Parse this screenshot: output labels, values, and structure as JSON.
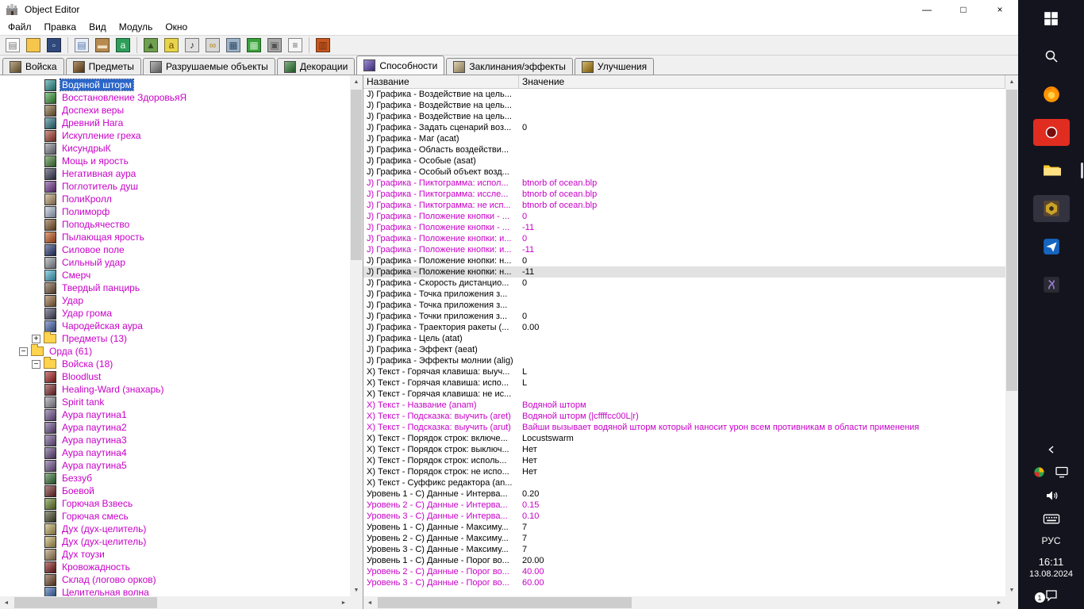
{
  "colors": {
    "modified_text": "#c800c8",
    "tree_selection_bg": "#2b66c9",
    "row_selection_bg": "#e2e2e2",
    "taskbar_bg": "#14141f",
    "red_app_highlight": "#e02d20"
  },
  "window": {
    "title": "Object Editor",
    "controls": {
      "minimize": "—",
      "maximize": "□",
      "close": "×"
    }
  },
  "menu": {
    "items": [
      {
        "name": "file",
        "label": "Файл"
      },
      {
        "name": "edit",
        "label": "Правка"
      },
      {
        "name": "view",
        "label": "Вид"
      },
      {
        "name": "module",
        "label": "Модуль"
      },
      {
        "name": "window",
        "label": "Окно"
      }
    ]
  },
  "toolbar": {
    "icons": [
      {
        "name": "new-document",
        "bg": "#fdfdfd",
        "fg": "#777777",
        "glyph": "▤"
      },
      {
        "name": "open-folder",
        "bg": "#f6c64c",
        "fg": "#7c5a14",
        "glyph": ""
      },
      {
        "name": "save",
        "bg": "#30497c",
        "fg": "#cfd8ea",
        "glyph": "▫"
      },
      {
        "name": "copy",
        "bg": "#e8eef8",
        "fg": "#5577aa",
        "glyph": "▤",
        "sep": true
      },
      {
        "name": "paste",
        "bg": "#b78a50",
        "fg": "#f0e0c0",
        "glyph": "▬"
      },
      {
        "name": "paste-special",
        "bg": "#2e9e5b",
        "fg": "#eaffea",
        "glyph": "a"
      },
      {
        "name": "terrain-editor",
        "bg": "#6f9f4f",
        "fg": "#2f4f1f",
        "glyph": "▲",
        "sep": true
      },
      {
        "name": "script-editor",
        "bg": "#e8d44a",
        "fg": "#6a4a00",
        "glyph": "a"
      },
      {
        "name": "sound-editor",
        "bg": "#e0e0e0",
        "fg": "#333333",
        "glyph": "♪"
      },
      {
        "name": "object-editor",
        "bg": "#d8d8d8",
        "fg": "#b8860b",
        "glyph": "∞"
      },
      {
        "name": "calculator",
        "bg": "#9fb4c8",
        "fg": "#2f4a66",
        "glyph": "▦"
      },
      {
        "name": "terrain-grid",
        "bg": "#3aa13a",
        "fg": "#c6edc6",
        "glyph": "▦"
      },
      {
        "name": "object-manager",
        "bg": "#a8a8a8",
        "fg": "#555555",
        "glyph": "▣"
      },
      {
        "name": "import-manager",
        "bg": "#f6f6f6",
        "fg": "#666666",
        "glyph": "≡"
      },
      {
        "name": "test-map",
        "bg": "#c8571e",
        "fg": "#6e2e10",
        "glyph": "▥",
        "sep": true
      }
    ]
  },
  "tabs": {
    "items": [
      {
        "name": "units",
        "label": "Войска",
        "color": "#8a6d3b",
        "active": false
      },
      {
        "name": "items",
        "label": "Предметы",
        "color": "#7b4a12",
        "active": false
      },
      {
        "name": "destructibles",
        "label": "Разрушаемые объекты",
        "color": "#888888",
        "active": false
      },
      {
        "name": "doodads",
        "label": "Декорации",
        "color": "#2e7d32",
        "active": false
      },
      {
        "name": "abilities",
        "label": "Способности",
        "color": "#5a3fb5",
        "active": true
      },
      {
        "name": "buffs",
        "label": "Заклинания/эффекты",
        "color": "#c9b37e",
        "active": false
      },
      {
        "name": "upgrades",
        "label": "Улучшения",
        "color": "#b8860b",
        "active": false
      }
    ]
  },
  "tree": {
    "items": [
      {
        "t": "Водяной шторм",
        "d": 3,
        "c": "#2e9e9e",
        "sel": true
      },
      {
        "t": "Восстановление ЗдоровьяЯ",
        "d": 3,
        "c": "#3da53d"
      },
      {
        "t": "Доспехи веры",
        "d": 3,
        "c": "#8a6a3a"
      },
      {
        "t": "Древний Нага",
        "d": 3,
        "c": "#2e7e8e"
      },
      {
        "t": "Искупление греха",
        "d": 3,
        "c": "#b04030"
      },
      {
        "t": "КисундрыК",
        "d": 3,
        "c": "#8a8a9a"
      },
      {
        "t": "Мощь и ярость",
        "d": 3,
        "c": "#4a8a3a"
      },
      {
        "t": "Негативная аура",
        "d": 3,
        "c": "#3a3a5a"
      },
      {
        "t": "Поглотитель душ",
        "d": 3,
        "c": "#7a3a9a"
      },
      {
        "t": "ПолиКролл",
        "d": 3,
        "c": "#c0a070"
      },
      {
        "t": "Полиморф",
        "d": 3,
        "c": "#b8c8e0"
      },
      {
        "t": "Поподьячество",
        "d": 3,
        "c": "#8a5a2a"
      },
      {
        "t": "Пылающая ярость",
        "d": 3,
        "c": "#d05a1a"
      },
      {
        "t": "Силовое поле",
        "d": 3,
        "c": "#2a3a7a"
      },
      {
        "t": "Сильный удар",
        "d": 3,
        "c": "#9aa0a8"
      },
      {
        "t": "Смерч",
        "d": 3,
        "c": "#4ab8d8"
      },
      {
        "t": "Твердый панцирь",
        "d": 3,
        "c": "#7a5a3a"
      },
      {
        "t": "Удар",
        "d": 3,
        "c": "#a07040"
      },
      {
        "t": "Удар грома",
        "d": 3,
        "c": "#4a4a6a"
      },
      {
        "t": "Чародейская аура",
        "d": 3,
        "c": "#4a6ab8"
      },
      {
        "t": "Предметы (13)",
        "d": 2,
        "folder": true,
        "exp": "plus"
      },
      {
        "t": "Орда (61)",
        "d": 1,
        "folder": true,
        "exp": "minus"
      },
      {
        "t": "Войска (18)",
        "d": 2,
        "folder": true,
        "exp": "minus"
      },
      {
        "t": "Bloodlust",
        "d": 3,
        "c": "#b02020"
      },
      {
        "t": "Healing-Ward (знахарь)",
        "d": 3,
        "c": "#8a2a2a"
      },
      {
        "t": "Spirit tank",
        "d": 3,
        "c": "#9a9aa5"
      },
      {
        "t": "Аура паутина1",
        "d": 3,
        "c": "#7a5a9a"
      },
      {
        "t": "Аура паутина2",
        "d": 3,
        "c": "#715293"
      },
      {
        "t": "Аура паутина3",
        "d": 3,
        "c": "#7a5a9a"
      },
      {
        "t": "Аура паутина4",
        "d": 3,
        "c": "#6a4a8a"
      },
      {
        "t": "Аура паутина5",
        "d": 3,
        "c": "#7a5a9a"
      },
      {
        "t": "Беззуб",
        "d": 3,
        "c": "#3a7a3a"
      },
      {
        "t": "Боевой",
        "d": 3,
        "c": "#7a2a2a"
      },
      {
        "t": "Горючая Взвесь",
        "d": 3,
        "c": "#6a8a2a"
      },
      {
        "t": "Горючая смесь",
        "d": 3,
        "c": "#4a4a2a"
      },
      {
        "t": "Дух (дух-целитель)",
        "d": 3,
        "c": "#c8b060"
      },
      {
        "t": "Дух (дух-целитель)",
        "d": 3,
        "c": "#c8b060"
      },
      {
        "t": "Дух тоузи",
        "d": 3,
        "c": "#b09060"
      },
      {
        "t": "Кровожадность",
        "d": 3,
        "c": "#8a1a1a"
      },
      {
        "t": "Склад (логово орков)",
        "d": 3,
        "c": "#7a4a2a"
      },
      {
        "t": "Целительная волна",
        "d": 3,
        "c": "#3a6ab8"
      }
    ]
  },
  "table": {
    "columns": [
      "Название",
      "Значение"
    ],
    "rows": [
      {
        "n": "J) Графика - Воздействие на цель...",
        "v": ""
      },
      {
        "n": "J) Графика - Воздействие на цель...",
        "v": ""
      },
      {
        "n": "J) Графика - Воздействие на цель...",
        "v": ""
      },
      {
        "n": "J) Графика - Задать сценарий воз...",
        "v": "0"
      },
      {
        "n": "J) Графика - Маг (acat)",
        "v": ""
      },
      {
        "n": "J) Графика - Область воздействи...",
        "v": ""
      },
      {
        "n": "J) Графика - Особые (asat)",
        "v": ""
      },
      {
        "n": "J) Графика - Особый объект возд...",
        "v": ""
      },
      {
        "n": "J) Графика - Пиктограмма: испол...",
        "v": "btnorb of ocean.blp",
        "m": true
      },
      {
        "n": "J) Графика - Пиктограмма: иссле...",
        "v": "btnorb of ocean.blp",
        "m": true
      },
      {
        "n": "J) Графика - Пиктограмма: не исп...",
        "v": "btnorb of ocean.blp",
        "m": true
      },
      {
        "n": "J) Графика - Положение кнопки - ...",
        "v": "0",
        "m": true
      },
      {
        "n": "J) Графика - Положение кнопки - ...",
        "v": "-11",
        "m": true
      },
      {
        "n": "J) Графика - Положение кнопки: и...",
        "v": "0",
        "m": true
      },
      {
        "n": "J) Графика - Положение кнопки: и...",
        "v": "-11",
        "m": true
      },
      {
        "n": "J) Графика - Положение кнопки: н...",
        "v": "0"
      },
      {
        "n": "J) Графика - Положение кнопки: н...",
        "v": "-11",
        "s": true
      },
      {
        "n": "J) Графика - Скорость дистанцио...",
        "v": "0"
      },
      {
        "n": "J) Графика - Точка приложения з...",
        "v": ""
      },
      {
        "n": "J) Графика - Точка приложения з...",
        "v": ""
      },
      {
        "n": "J) Графика - Точки приложения з...",
        "v": "0"
      },
      {
        "n": "J) Графика - Траектория ракеты (...",
        "v": "0.00"
      },
      {
        "n": "J) Графика - Цель (atat)",
        "v": ""
      },
      {
        "n": "J) Графика - Эффект (aeat)",
        "v": ""
      },
      {
        "n": "J) Графика - Эффекты молнии (alig)",
        "v": ""
      },
      {
        "n": "X) Текст - Горячая клавиша: выуч...",
        "v": "L"
      },
      {
        "n": "X) Текст - Горячая клавиша: испо...",
        "v": "L"
      },
      {
        "n": "X) Текст - Горячая клавиша: не ис...",
        "v": ""
      },
      {
        "n": "X) Текст - Название (anam)",
        "v": "Водяной шторм",
        "m": true
      },
      {
        "n": "X) Текст - Подсказка: выучить (aret)",
        "v": "Водяной шторм (|cffffcc00L|r)",
        "m": true
      },
      {
        "n": "X) Текст - Подсказка: выучить (arut)",
        "v": "Вайши вызывает водяной шторм который наносит урон всем противникам в области применения",
        "m": true
      },
      {
        "n": "X) Текст - Порядок строк: включе...",
        "v": "Locustswarm"
      },
      {
        "n": "X) Текст - Порядок строк: выключ...",
        "v": "Нет"
      },
      {
        "n": "X) Текст - Порядок строк: исполь...",
        "v": "Нет"
      },
      {
        "n": "X) Текст - Порядок строк: не испо...",
        "v": "Нет"
      },
      {
        "n": "X) Текст - Суффикс редактора (an...",
        "v": ""
      },
      {
        "n": "Уровень 1 - С) Данные - Интерва...",
        "v": "0.20"
      },
      {
        "n": "Уровень 2 - С) Данные - Интерва...",
        "v": "0.15",
        "m": true
      },
      {
        "n": "Уровень 3 - С) Данные - Интерва...",
        "v": "0.10",
        "m": true
      },
      {
        "n": "Уровень 1 - С) Данные - Максиму...",
        "v": "7"
      },
      {
        "n": "Уровень 2 - С) Данные - Максиму...",
        "v": "7"
      },
      {
        "n": "Уровень 3 - С) Данные - Максиму...",
        "v": "7"
      },
      {
        "n": "Уровень 1 - С) Данные - Порог во...",
        "v": "20.00"
      },
      {
        "n": "Уровень 2 - С) Данные - Порог во...",
        "v": "40.00",
        "m": true
      },
      {
        "n": "Уровень 3 - С) Данные - Порог во...",
        "v": "60.00",
        "m": true
      }
    ]
  },
  "taskbar": {
    "apps": [
      {
        "name": "start"
      },
      {
        "name": "search"
      },
      {
        "name": "firefox"
      },
      {
        "name": "red-app",
        "highlight": "#e02d20"
      },
      {
        "name": "explorer",
        "indicator": true
      },
      {
        "name": "wc3-editor",
        "active": true
      },
      {
        "name": "blue-app"
      },
      {
        "name": "dark-app"
      }
    ],
    "tray": {
      "icons": [
        "chevron-left",
        "tray-apps",
        "display",
        "volume",
        "touch-keyboard"
      ],
      "language": "РУС",
      "time": "16:11",
      "date": "13.08.2024",
      "notification_badge": "1"
    }
  }
}
